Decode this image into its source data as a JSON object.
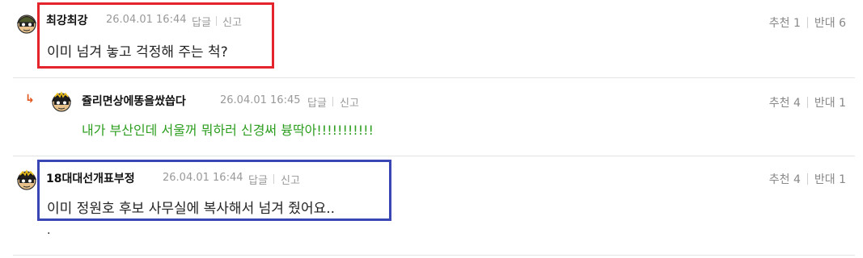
{
  "comments": [
    {
      "nickname": "최강최강",
      "date": "26.04.01 16:44",
      "reply": "답글",
      "report": "신고",
      "text": "이미 넘겨 놓고 걱정해 주는 척?",
      "recommend_label": "추천",
      "recommend_count": "1",
      "oppose_label": "반대",
      "oppose_count": "6"
    },
    {
      "nickname": "쥴리면상에똥을쌌씁다",
      "date": "26.04.01 16:45",
      "reply": "답글",
      "report": "신고",
      "text": "내가 부산인데 서울꺼 뭐하러 신경써 븅딱아!!!!!!!!!!!",
      "recommend_label": "추천",
      "recommend_count": "4",
      "oppose_label": "반대",
      "oppose_count": "1"
    },
    {
      "nickname": "18대대선개표부정",
      "date": "26.04.01 16:44",
      "reply": "답글",
      "report": "신고",
      "text": "이미 정원호 후보 사무실에 복사해서 넘겨 줬어요..",
      "extra": ".",
      "recommend_label": "추천",
      "recommend_count": "4",
      "oppose_label": "반대",
      "oppose_count": "1"
    }
  ],
  "colors": {
    "highlight_red": "#e3242b",
    "highlight_blue": "#3b46b5",
    "reply_text_green": "#2d9e1f",
    "reply_arrow": "#e2571e"
  },
  "icons": {
    "avatar": "soldier-helmet-avatar-icon",
    "reply_marker": "reply-arrow-icon"
  }
}
